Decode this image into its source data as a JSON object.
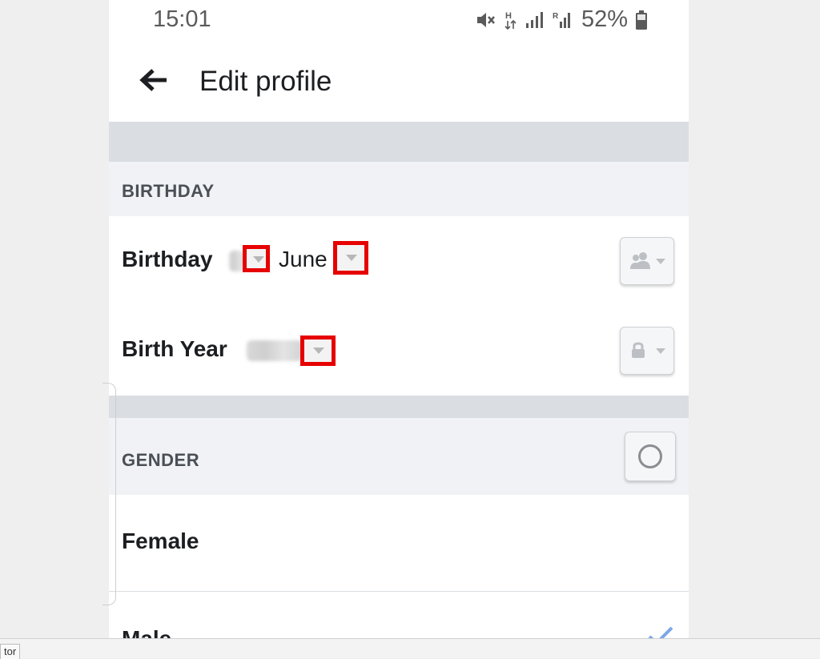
{
  "status_bar": {
    "time": "15:01",
    "battery": "52%"
  },
  "header": {
    "title": "Edit profile"
  },
  "birthday_section": {
    "header": "BIRTHDAY",
    "birthday_label": "Birthday",
    "month": "June",
    "birth_year_label": "Birth Year"
  },
  "gender_section": {
    "header": "GENDER",
    "options": [
      "Female",
      "Male"
    ],
    "selected": "Male"
  },
  "bottom_tab": {
    "label": "tor"
  },
  "colors": {
    "highlight": "#e60000",
    "accent": "#1877f2",
    "section_bg": "#f0f2f5"
  }
}
